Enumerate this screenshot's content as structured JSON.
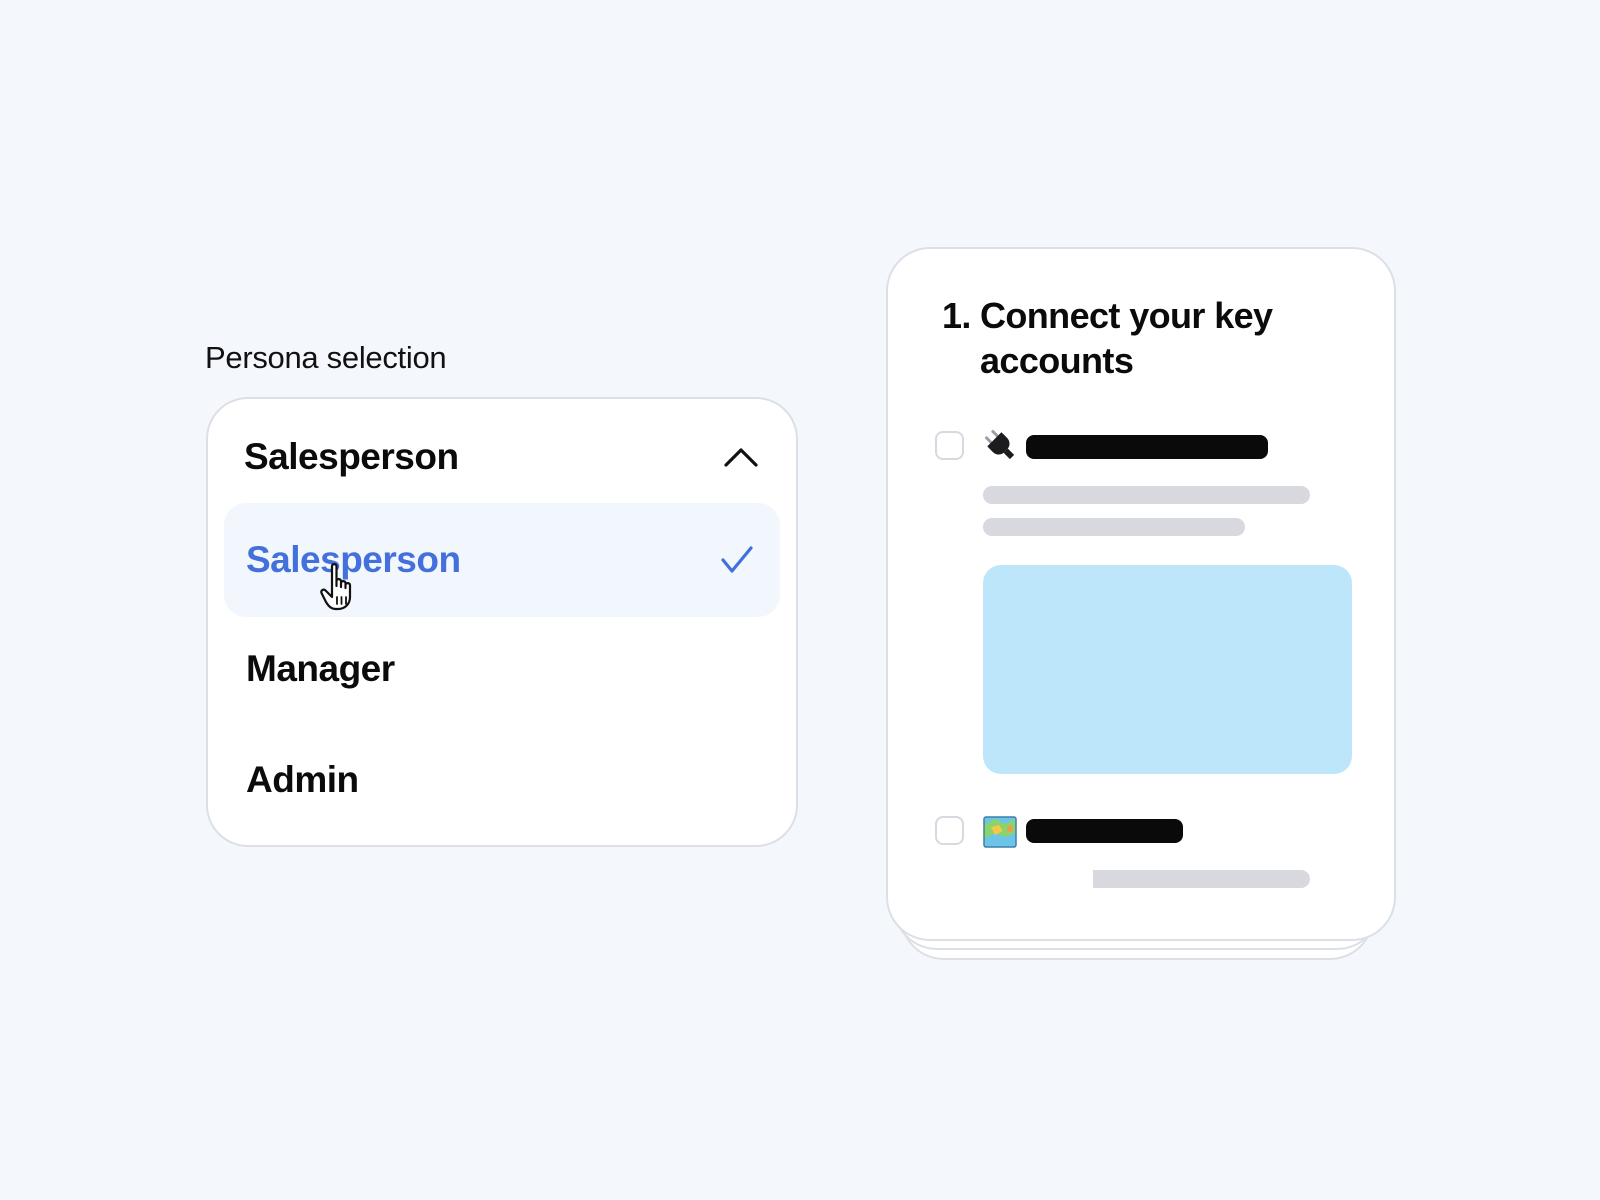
{
  "persona": {
    "label": "Persona selection",
    "selected_value": "Salesperson",
    "options": [
      {
        "label": "Salesperson",
        "selected": true
      },
      {
        "label": "Manager",
        "selected": false
      },
      {
        "label": "Admin",
        "selected": false
      }
    ],
    "icons": {
      "toggle": "chevron-up-icon",
      "selected_marker": "checkmark-icon",
      "pointer": "hand-pointer-cursor-icon"
    }
  },
  "onboarding_card": {
    "step_number": "1.",
    "title": "Connect your key accounts",
    "items": [
      {
        "icon": "electric-plug-icon",
        "checked": false
      },
      {
        "icon": "map-icon",
        "checked": false
      }
    ]
  },
  "colors": {
    "background": "#f4f8fd",
    "accent": "#4470dc",
    "selected_row": "#f2f6fd",
    "media_placeholder": "#bee6fb",
    "placeholder_dark": "#0a0a0a",
    "placeholder_light": "#d7d9de",
    "border": "#dcdfe5"
  }
}
